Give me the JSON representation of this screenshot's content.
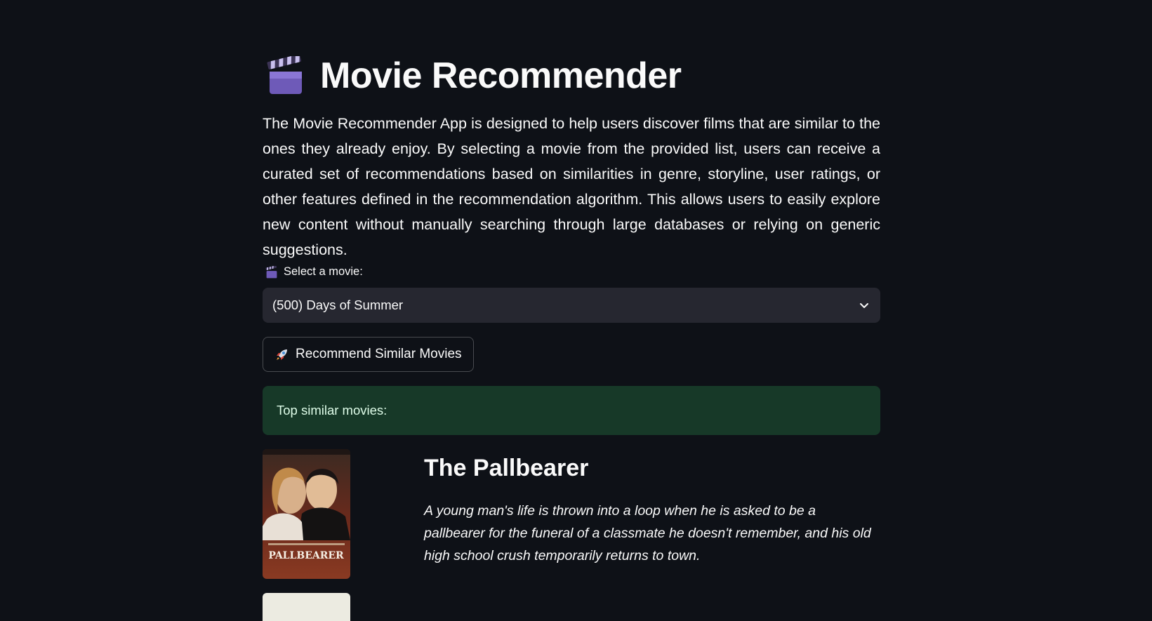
{
  "app": {
    "title": "Movie Recommender",
    "title_icon": "clapper-board-icon",
    "description": "The Movie Recommender App is designed to help users discover films that are similar to the ones they already enjoy. By selecting a movie from the provided list, users can receive a curated set of recommendations based on similarities in genre, storyline, user ratings, or other features defined in the recommendation algorithm. This allows users to easily explore new content without manually searching through large databases or relying on generic suggestions."
  },
  "select": {
    "label": "Select a movie:",
    "label_icon": "clapper-board-icon",
    "value": "(500) Days of Summer",
    "chevron_icon": "chevron-down-icon"
  },
  "button": {
    "label": "Recommend Similar Movies",
    "icon": "rocket-icon"
  },
  "results": {
    "heading": "Top similar movies:",
    "movies": [
      {
        "title": "The Pallbearer",
        "overview": "A young man's life is thrown into a loop when he is asked to be a pallbearer for the funeral of a classmate he doesn't remember, and his old high school crush temporarily returns to town.",
        "poster_text": "PALLBEARER"
      }
    ]
  },
  "colors": {
    "background": "#0e1117",
    "text": "#fafafa",
    "input_bg": "#262730",
    "success_bg": "#173928",
    "success_text": "#dffde9"
  }
}
